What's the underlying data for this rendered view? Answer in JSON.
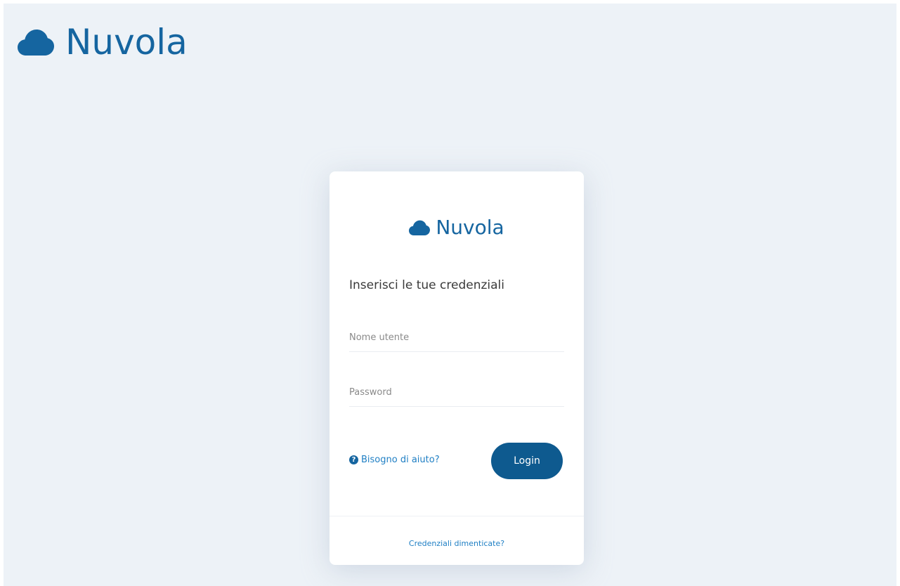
{
  "header": {
    "logo_icon": "cloud-icon",
    "brand": "Nuvola"
  },
  "login_card": {
    "logo_icon": "cloud-icon",
    "brand": "Nuvola",
    "heading": "Inserisci le tue credenziali",
    "username": {
      "placeholder": "Nome utente",
      "value": ""
    },
    "password": {
      "placeholder": "Password",
      "value": ""
    },
    "help": {
      "icon": "question-circle-icon",
      "label": "Bisogno di aiuto?"
    },
    "login_button": "Login",
    "forgot_link": "Credenziali dimenticate?"
  },
  "colors": {
    "brand": "#1565a0",
    "button": "#0e5a8f",
    "link": "#1f7fc4",
    "background": "#edf2f7",
    "card": "#ffffff"
  }
}
